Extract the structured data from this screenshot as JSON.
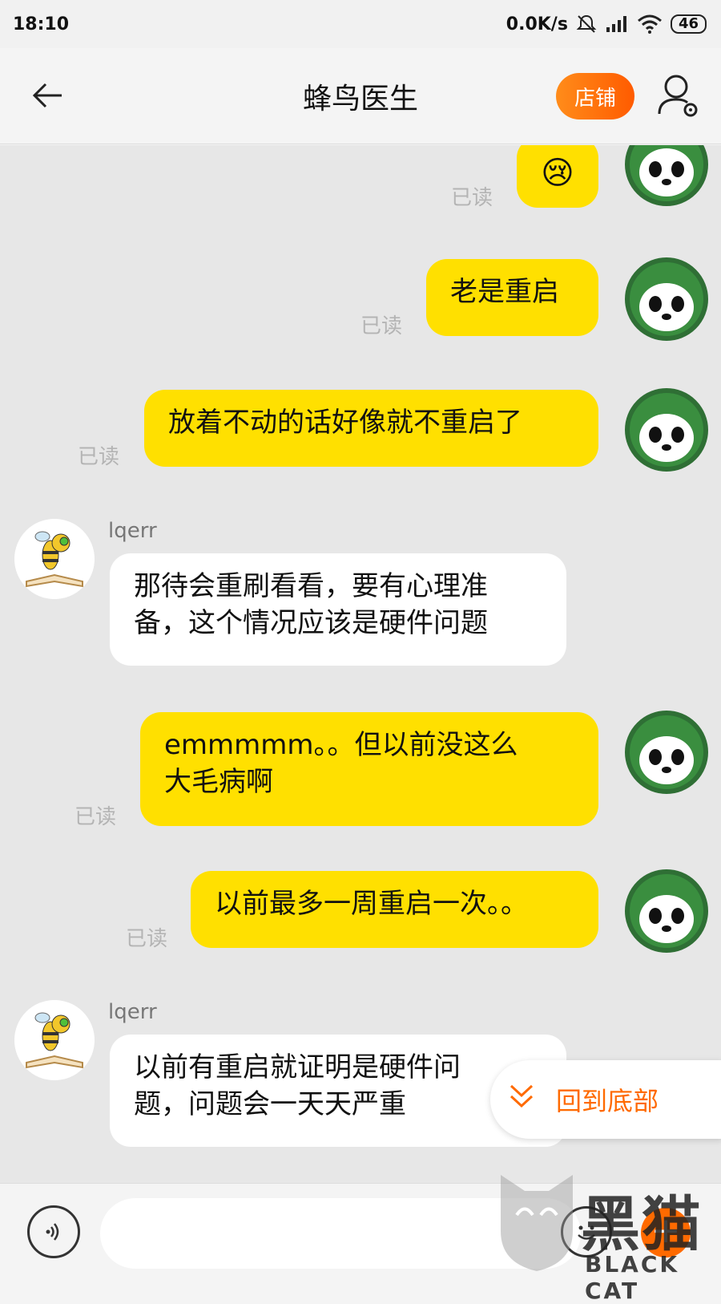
{
  "status_bar": {
    "time": "18:10",
    "network_speed": "0.0K/s",
    "battery": "46",
    "icons": [
      "mute-icon",
      "signal-icon",
      "wifi-icon",
      "battery-icon"
    ]
  },
  "header": {
    "title": "蜂鸟医生",
    "shop_button": "店铺",
    "icons": [
      "back-arrow-icon",
      "user-settings-icon"
    ]
  },
  "messages": [
    {
      "sender": "me",
      "type": "emoji",
      "content": "😢",
      "status": "已读"
    },
    {
      "sender": "me",
      "type": "text",
      "lines": [
        "老是重启"
      ],
      "status": "已读"
    },
    {
      "sender": "me",
      "type": "text",
      "lines": [
        "放着不动的话好像就不重启了"
      ],
      "status": "已读"
    },
    {
      "sender": "them",
      "name": "lqerr",
      "type": "text",
      "lines": [
        "那待会重刷看看，要有心理准",
        "备，这个情况应该是硬件问题"
      ]
    },
    {
      "sender": "me",
      "type": "text",
      "lines": [
        "emmmmm。。但以前没这么",
        "大毛病啊"
      ],
      "status": "已读"
    },
    {
      "sender": "me",
      "type": "text",
      "lines": [
        "以前最多一周重启一次。。"
      ],
      "status": "已读"
    },
    {
      "sender": "them",
      "name": "lqerr",
      "type": "text",
      "lines": [
        "以前有重启就证明是硬件问",
        "题，问题会一天天严重"
      ]
    }
  ],
  "back_to_bottom": "回到底部",
  "input": {
    "placeholder": ""
  },
  "watermark": {
    "cn": "黑猫",
    "en": "BLACK CAT"
  },
  "colors": {
    "my_bubble": "#ffe000",
    "their_bubble": "#ffffff",
    "accent": "#ff6a00",
    "read_status": "#b4b4b4"
  }
}
